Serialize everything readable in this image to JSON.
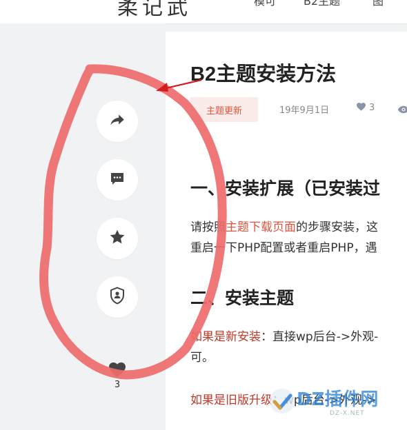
{
  "header": {
    "logo_text": "柔记武",
    "nav_items": [
      "模可",
      "B2主题",
      "图"
    ]
  },
  "sidebar": {
    "actions": [
      {
        "name": "share",
        "icon": "share-arrow-icon"
      },
      {
        "name": "comment",
        "icon": "comment-dots-icon"
      },
      {
        "name": "favorite",
        "icon": "star-icon"
      },
      {
        "name": "report",
        "icon": "shield-user-icon"
      }
    ],
    "like_icon": "heart-icon",
    "like_count": "3"
  },
  "article": {
    "title": "B2主题安装方法",
    "category": "主题更新",
    "date": "19年9月1日",
    "likes": "3",
    "section1_heading": "一、安装扩展（已安装过",
    "section1_line1_prefix": "请按照",
    "section1_line1_link": "主题下载页面",
    "section1_line1_suffix": "的步骤安装，这",
    "section1_line2": "重启一下PHP配置或者重启PHP，遇",
    "section2_heading": "二、安装主题",
    "section2_line1_red": "如果是新安装",
    "section2_line1_rest": "：直接wp后台->外观-",
    "section2_line2": "可。",
    "section2_line3_red": "如果是旧版升级",
    "section2_line3_rest": "：wp后台->外观->"
  },
  "watermark": {
    "text": "DZ插件网",
    "sub": "DZ-X.NET"
  },
  "colors": {
    "accent": "#e0533d",
    "annotation": "#ee6b6b",
    "arrow": "#d11f1f"
  }
}
